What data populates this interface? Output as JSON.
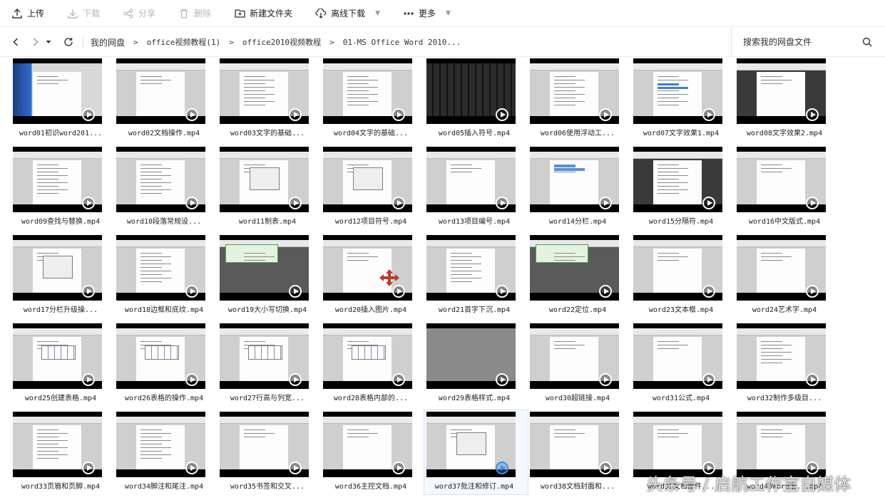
{
  "toolbar": {
    "upload": "上传",
    "download": "下载",
    "share": "分享",
    "delete": "删除",
    "new_folder": "新建文件夹",
    "offline_download": "离线下载",
    "more": "更多"
  },
  "breadcrumb": {
    "items": [
      "我的网盘",
      "office视频教程(1)",
      "office2010视频教程",
      "01-MS Office Word 2010..."
    ],
    "separator": ">"
  },
  "search": {
    "placeholder": "搜索我的网盘文件"
  },
  "files": [
    "word01初识word201...",
    "word02文档操作.mp4",
    "word03文字的基础...",
    "word04文字的基础...",
    "word05插入符号.mp4",
    "word06使用浮动工...",
    "word07文字效果1.mp4",
    "word08文字效果2.mp4",
    "word09查找与替换.mp4",
    "word10段落常规设...",
    "word11制表.mp4",
    "word12项目符号.mp4",
    "word13项目编号.mp4",
    "word14分栏.mp4",
    "word15分隔符.mp4",
    "word16中文版式.mp4",
    "word17分栏升级操...",
    "word18边框和底纹.mp4",
    "word19大小写切换.mp4",
    "word20插入图片.mp4",
    "word21首字下沉.mp4",
    "word22定位.mp4",
    "word23文本框.mp4",
    "word24艺术字.mp4",
    "word25创建表格.mp4",
    "word26表格的操作.mp4",
    "word27行高与列宽...",
    "word28表格内部的...",
    "word29表格样式.mp4",
    "word30超链接.mp4",
    "word31公式.mp4",
    "word32制作多级目...",
    "word33页眉和页脚.mp4",
    "word34脚注和尾注.mp4",
    "word35书签和交叉...",
    "word36主控文档.mp4",
    "word37批注和修订.mp4",
    "word38文档封面和...",
    "word39文档部件...",
    "word40Word宏...mp4"
  ],
  "selected_file": "word37批注和修订.mp4",
  "watermark": "头条号 / 启航工作室自媒体",
  "icons": {
    "upload": "upload-icon",
    "download": "download-icon",
    "share": "share-icon",
    "delete": "trash-icon",
    "new_folder": "folder-plus-icon",
    "offline": "cloud-download-icon",
    "more": "more-dots-icon",
    "back": "chevron-left-icon",
    "forward": "chevron-right-icon",
    "history": "caret-down-icon",
    "refresh": "refresh-icon",
    "search": "search-icon",
    "play": "play-icon"
  },
  "colors": {
    "accent": "#3b8fe8",
    "text": "#222222",
    "disabled": "#b8b8b8",
    "thumb_bg": "#000000"
  }
}
